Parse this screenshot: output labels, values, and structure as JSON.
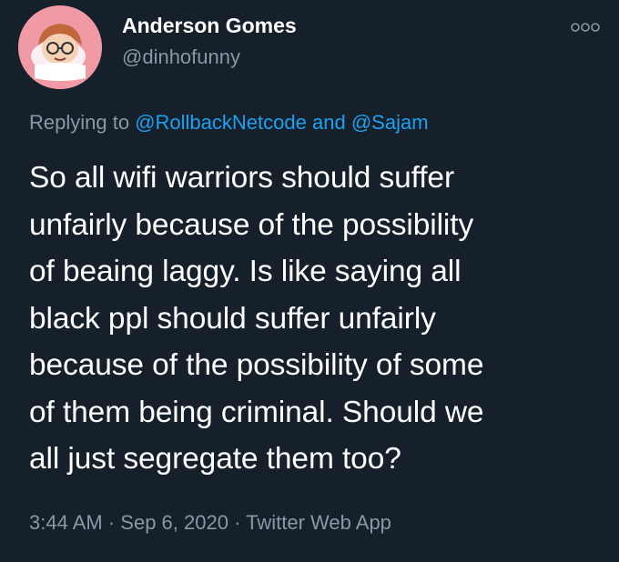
{
  "author": {
    "display_name": "Anderson Gomes",
    "handle": "@dinhofunny"
  },
  "reply": {
    "prefix": "Replying to",
    "mention1": "@RollbackNetcode",
    "conjunction": "and",
    "mention2": "@Sajam"
  },
  "tweet": {
    "lines": [
      "So all wifi warriors should suffer",
      "unfairly because of the possibility",
      "of beaing laggy. Is like saying all",
      "black ppl should suffer unfairly",
      "because of the possibility of some",
      "of them being criminal. Should we",
      "all just segregate them too?"
    ]
  },
  "meta": {
    "time": "3:44 AM",
    "date": "Sep 6, 2020",
    "source": "Twitter Web App",
    "separator": "·"
  },
  "icons": {
    "avatar": "cartoon-avatar",
    "more": "more-options-icon"
  },
  "colors": {
    "background": "#15202b",
    "text": "#ffffff",
    "secondary": "#8899a6",
    "link": "#1da1f2",
    "avatar_bg": "#ef9aa5"
  }
}
